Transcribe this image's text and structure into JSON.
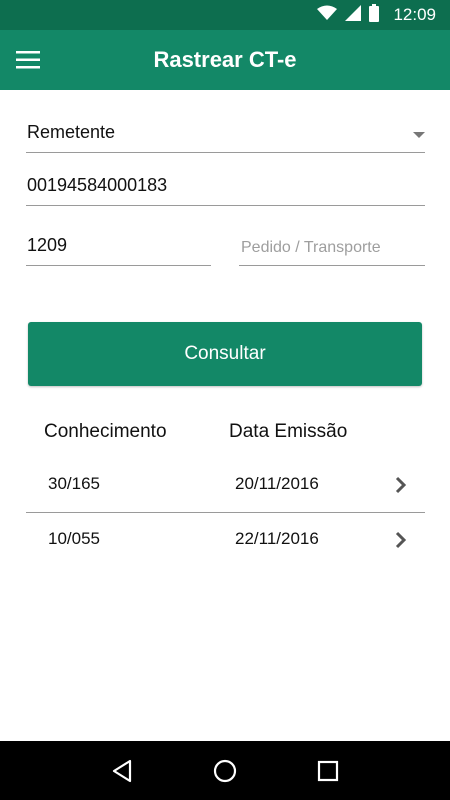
{
  "status_bar": {
    "time": "12:09"
  },
  "app_bar": {
    "title": "Rastrear CT-e",
    "menu_icon": "hamburger-menu-icon"
  },
  "form": {
    "tipo": {
      "value": "Remetente"
    },
    "cnpj": {
      "value": "00194584000183"
    },
    "numero": {
      "value": "1209"
    },
    "pedido": {
      "value": "",
      "placeholder": "Pedido / Transporte"
    },
    "submit_label": "Consultar"
  },
  "results": {
    "headers": {
      "conhecimento": "Conhecimento",
      "data_emissao": "Data Emissão"
    },
    "rows": [
      {
        "conhecimento": "30/165",
        "data_emissao": "20/11/2016"
      },
      {
        "conhecimento": "10/055",
        "data_emissao": "22/11/2016"
      }
    ]
  },
  "colors": {
    "primary": "#138867",
    "status_bar": "#0d6e4f"
  }
}
